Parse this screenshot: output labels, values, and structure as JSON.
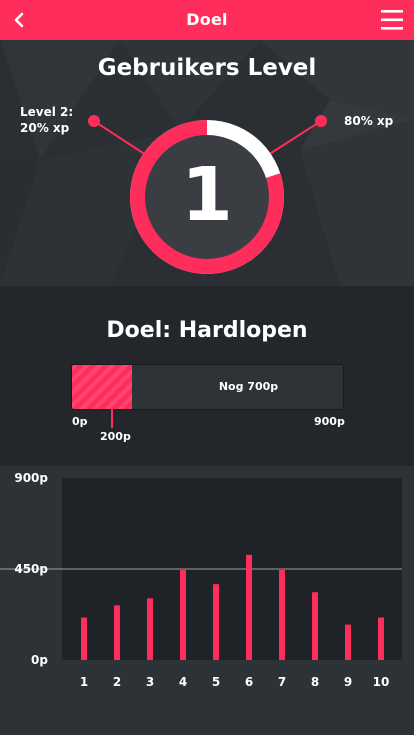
{
  "header": {
    "title": "Doel",
    "back_icon": "chevron-left-icon",
    "menu_icon": "hamburger-menu-icon"
  },
  "level": {
    "title": "Gebruikers Level",
    "number": "1",
    "next_level_label": "Level 2:",
    "next_level_value": "20% xp",
    "progress_label": "80% xp",
    "progress_fraction": 0.8
  },
  "goal": {
    "title": "Doel: Hardlopen",
    "remaining_label": "Nog 700p",
    "min_label": "0p",
    "max_label": "900p",
    "current_label": "200p",
    "current_value": 200,
    "max_value": 900
  },
  "colors": {
    "accent": "#ff2d5b",
    "background": "#262a2e",
    "panel": "#23272b"
  },
  "chart_data": {
    "type": "bar",
    "categories": [
      "1",
      "2",
      "3",
      "4",
      "5",
      "6",
      "7",
      "8",
      "9",
      "10"
    ],
    "values": [
      210,
      270,
      305,
      445,
      375,
      520,
      445,
      335,
      175,
      210
    ],
    "ylim": [
      0,
      900
    ],
    "yticks": [
      "0p",
      "450p",
      "900p"
    ],
    "reference_line": 450,
    "grid": false
  }
}
